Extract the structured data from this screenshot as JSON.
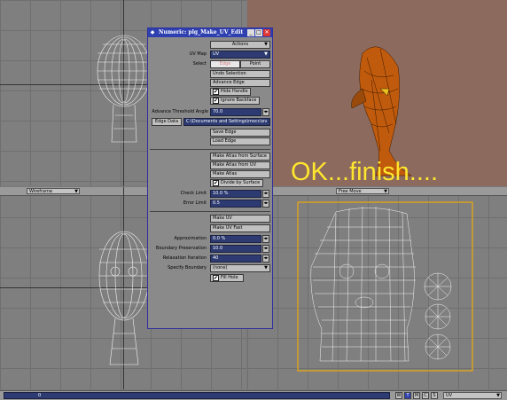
{
  "dialog": {
    "title": "Numeric: plg_Make_UV_Edit",
    "actions_select": "Actions",
    "uv_map_label": "UV Map",
    "uv_map_value": "UV",
    "select_label": "Select",
    "select_edge": "Edge",
    "select_point": "Point",
    "undo_selection": "Undo Selection",
    "advance_edge": "Advance Edge",
    "hide_handle": "Hide Handle",
    "ignore_backface": "Ignore Backface",
    "threshold_label": "Advance Threshold Angle",
    "threshold_value": "70.0",
    "edge_data": "Edge Data",
    "edge_data_path": "C:\\Documents and Settings\\mocc\\ev",
    "save_edge": "Save Edge",
    "load_edge": "Load Edge",
    "atlas_surface": "Make Atlas from Surface",
    "atlas_uv": "Make Atlas from UV",
    "make_atlas": "Make Atlas",
    "divide_surface": "Divide by Surface",
    "check_limit_label": "Check Limit",
    "check_limit_value": "10.0 %",
    "error_limit_label": "Error Limit",
    "error_limit_value": "0.5",
    "make_uv": "Make UV",
    "make_uv_fast": "Make UV Fast",
    "approx_label": "Approximation",
    "approx_value": "0.0 %",
    "boundary_label": "Boundary Preservation",
    "boundary_value": "10.0",
    "relax_label": "Relaxation Iteration",
    "relax_value": "40",
    "specify_label": "Specify Boundary",
    "specify_value": "(none)",
    "fill_hole": "Fill Hole",
    "check_mark": "✔"
  },
  "viewports": {
    "bottom_left_mode": "Wireframe",
    "bottom_right_mode": "Free Move"
  },
  "overlay_text": "OK...finish....",
  "status": {
    "left_value": "0",
    "buttons": [
      "W",
      "T",
      "M",
      "C",
      "S"
    ],
    "uv_select": "UV"
  },
  "colors": {
    "title_bar": "#2e3fb0",
    "field_bg": "#2d3b72",
    "overlay_text": "#ffe62e",
    "uv_frame": "#d9a020",
    "perspective_bg": "#8c6a5e",
    "mesh_orange": "#c05a0c"
  }
}
